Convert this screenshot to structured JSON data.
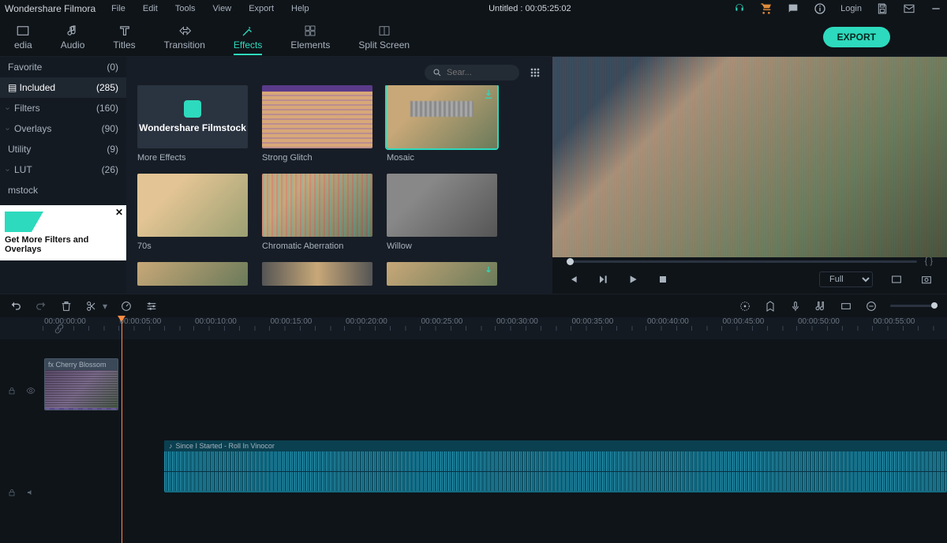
{
  "app": {
    "name": "Wondershare Filmora",
    "title": "Untitled : 00:05:25:02",
    "login": "Login"
  },
  "menu": [
    "File",
    "Edit",
    "Tools",
    "View",
    "Export",
    "Help"
  ],
  "tabs": [
    {
      "id": "media",
      "label": "edia"
    },
    {
      "id": "audio",
      "label": "Audio"
    },
    {
      "id": "titles",
      "label": "Titles"
    },
    {
      "id": "transition",
      "label": "Transition"
    },
    {
      "id": "effects",
      "label": "Effects"
    },
    {
      "id": "elements",
      "label": "Elements"
    },
    {
      "id": "splitscreen",
      "label": "Split Screen"
    }
  ],
  "export_label": "EXPORT",
  "sidebar": {
    "items": [
      {
        "label": "Favorite",
        "count": "(0)"
      },
      {
        "label": "Included",
        "count": "(285)",
        "selected": true,
        "icon": "list"
      },
      {
        "label": "Filters",
        "count": "(160)",
        "sub": true
      },
      {
        "label": "Overlays",
        "count": "(90)",
        "sub": true
      },
      {
        "label": "Utility",
        "count": "(9)"
      },
      {
        "label": "LUT",
        "count": "(26)",
        "sub": true
      },
      {
        "label": "mstock",
        "count": ""
      }
    ],
    "ad": "Get More Filters and Overlays"
  },
  "search_placeholder": "Sear...",
  "effects": [
    {
      "name": "More Effects",
      "type": "filmstock",
      "brand": "Wondershare Filmstock"
    },
    {
      "name": "Strong Glitch"
    },
    {
      "name": "Mosaic",
      "selected": true,
      "download": true
    },
    {
      "name": "70s"
    },
    {
      "name": "Chromatic Aberration"
    },
    {
      "name": "Willow"
    }
  ],
  "preview": {
    "quality": "Full",
    "braces": "{   }"
  },
  "timeline": {
    "ticks": [
      "00:00:00:00",
      "00:00:05:00",
      "00:00:10:00",
      "00:00:15:00",
      "00:00:20:00",
      "00:00:25:00",
      "00:00:30:00",
      "00:00:35:00",
      "00:00:40:00",
      "00:00:45:00",
      "00:00:50:00",
      "00:00:55:00"
    ],
    "video_clip": "Cherry Blossom",
    "audio_clip": "Since I Started - Roll In Vinocor"
  }
}
